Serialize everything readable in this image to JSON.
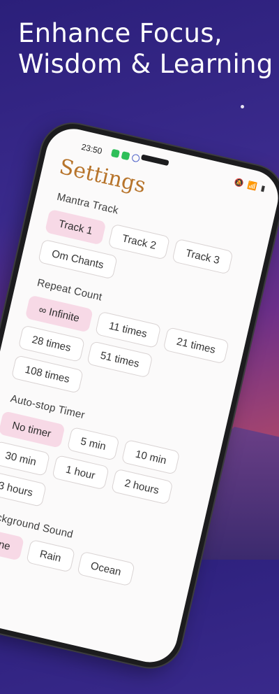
{
  "headline": "Enhance Focus, Wisdom & Learning",
  "status_bar": {
    "time": "23:50"
  },
  "settings": {
    "title": "Settings",
    "sections": [
      {
        "label": "Mantra Track",
        "options": [
          "Track 1",
          "Track 2",
          "Track 3",
          "Om Chants"
        ],
        "selected": "Track 1"
      },
      {
        "label": "Repeat Count",
        "options": [
          "∞ Infinite",
          "11 times",
          "21 times",
          "28 times",
          "51 times",
          "108 times"
        ],
        "selected": "∞ Infinite"
      },
      {
        "label": "Auto-stop Timer",
        "options": [
          "No timer",
          "5 min",
          "10 min",
          "30 min",
          "1 hour",
          "2 hours",
          "3 hours"
        ],
        "selected": "No timer"
      },
      {
        "label": "Background Sound",
        "options": [
          "None",
          "Rain",
          "Ocean"
        ],
        "selected": "None"
      }
    ]
  },
  "colors": {
    "title": "#b7742b",
    "selected_chip": "#f7d9e6",
    "background_top": "#2b1f7a",
    "background_bottom": "#c7545a"
  }
}
